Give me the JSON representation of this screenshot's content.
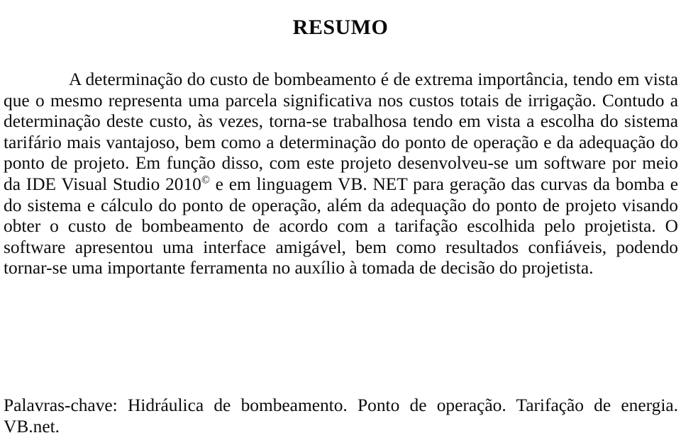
{
  "document": {
    "language": "pt-BR",
    "page_type": "abstract",
    "background_color": "#ffffff",
    "text_color": "#0c0c0c"
  },
  "heading": {
    "text": "RESUMO"
  },
  "abstract": {
    "paragraph_indent_text": "",
    "text_part1": "A determinação do custo de bombeamento é de extrema importância, tendo em vista que o mesmo representa uma parcela significativa nos custos totais de irrigação. Contudo a determinação deste custo, às vezes, torna-se trabalhosa tendo em vista a escolha do sistema tarifário mais vantajoso, bem como a determinação do ponto de operação e da adequação do ponto de projeto. Em função disso, com este projeto desenvolveu-se um software por meio da IDE Visual Studio 2010",
    "superscript_symbol": "©",
    "text_part2": " e em linguagem VB. NET para geração das curvas da bomba e do sistema e cálculo do ponto de operação, além da adequação do ponto de projeto visando obter o custo de bombeamento de acordo com a tarifação escolhida pelo projetista. O software apresentou uma interface amigável, bem como resultados confiáveis, podendo tornar-se uma importante ferramenta no auxílio à tomada de decisão do projetista.",
    "lines": [
      "A determinação do custo de bombeamento é de extrema importância,",
      "tendo em vista que o mesmo representa uma parcela significativa nos custos",
      "totais de irrigação. Contudo a determinação deste custo, às vezes, torna-se",
      "trabalhosa tendo em vista a escolha do sistema tarifário mais vantajoso, bem",
      "como a determinação do ponto de operação e da adequação do ponto de projeto.",
      "Em função disso, com este projeto desenvolveu-se um software por meio da IDE",
      "Visual Studio 2010© e em linguagem VB. NET para geração das curvas da",
      "bomba e do sistema e cálculo do ponto de operação, além da adequação do",
      "ponto de projeto visando obter o custo de bombeamento de acordo com a",
      "tarifação escolhida pelo projetista. O software apresentou uma interface",
      "amigável, bem como resultados confiáveis, podendo tornar-se uma importante",
      "ferramenta no auxílio à tomada de decisão do projetista."
    ]
  },
  "keywords": {
    "label": "Palavras-chave:",
    "text": "Palavras-chave: Hidráulica de bombeamento. Ponto de operação. Tarifação de energia. VB.net.",
    "terms": [
      "Hidráulica de bombeamento.",
      "Ponto de operação.",
      "Tarifação de energia.",
      "VB.net."
    ],
    "lines": [
      "Palavras-chave: Hidráulica de bombeamento. Ponto de operação. Tarifação de",
      "energia. VB.net."
    ]
  }
}
